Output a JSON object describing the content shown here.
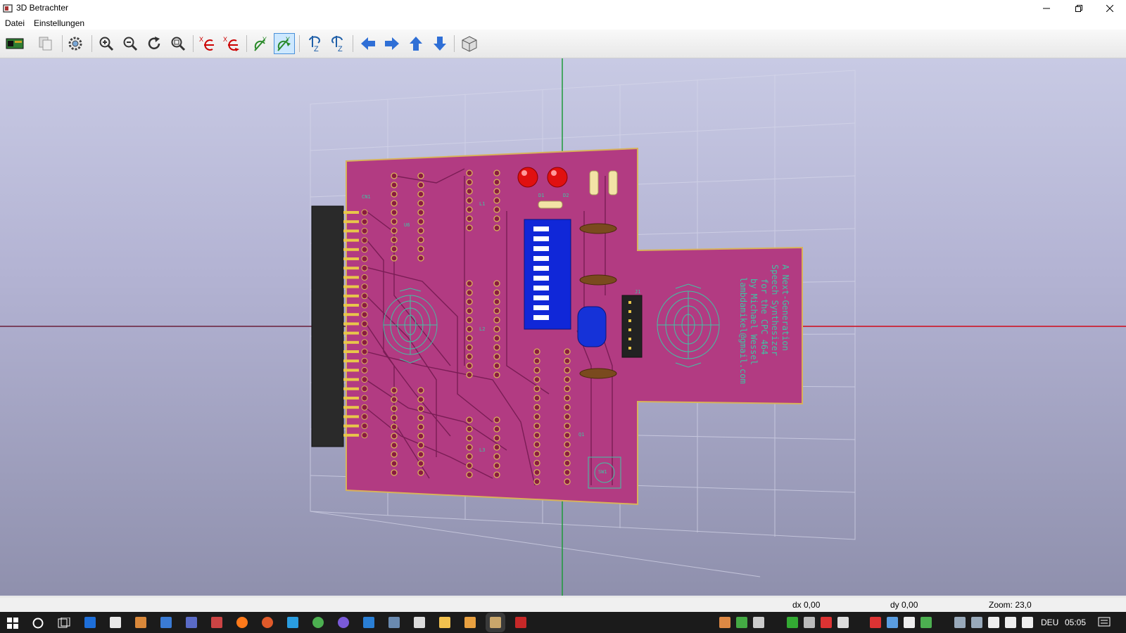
{
  "window": {
    "title": "3D Betrachter",
    "controls": {
      "minimize": "minimize",
      "maximize": "restore",
      "close": "close"
    }
  },
  "menu": {
    "items": [
      "Datei",
      "Einstellungen"
    ]
  },
  "toolbar": {
    "buttons": [
      "reload-board-icon",
      "copy-image-icon",
      "settings-gear-icon",
      "zoom-in-icon",
      "zoom-out-icon",
      "redraw-icon",
      "zoom-fit-icon",
      "rotate-x-cw-icon",
      "rotate-x-ccw-icon",
      "rotate-y-cw-icon",
      "rotate-y-ccw-icon",
      "rotate-z-cw-icon",
      "rotate-z-ccw-icon",
      "move-left-icon",
      "move-right-icon",
      "move-up-icon",
      "move-down-icon",
      "toggle-ortho-icon"
    ],
    "active_button": "rotate-y-ccw-icon"
  },
  "viewport": {
    "background_top": "#c8cae4",
    "background_bottom": "#8f90ad",
    "board_color": "#b23b82",
    "silkscreen_color": "#40c4a4",
    "board_text": [
      "A Next-Generation",
      "Speech Synthesizer",
      "for the CPC 464",
      "by Michael Wessel",
      "lambdamikel@gmail.com"
    ],
    "ref_labels": [
      "CN1",
      "U6",
      "L1",
      "L2",
      "L3",
      "D1",
      "D2",
      "J1",
      "SW1",
      "Q1"
    ]
  },
  "status": {
    "dx": "dx 0,00",
    "dy": "dy 0,00",
    "zoom": "Zoom: 23,0"
  },
  "taskbar": {
    "language": "DEU",
    "time": "05:05"
  }
}
